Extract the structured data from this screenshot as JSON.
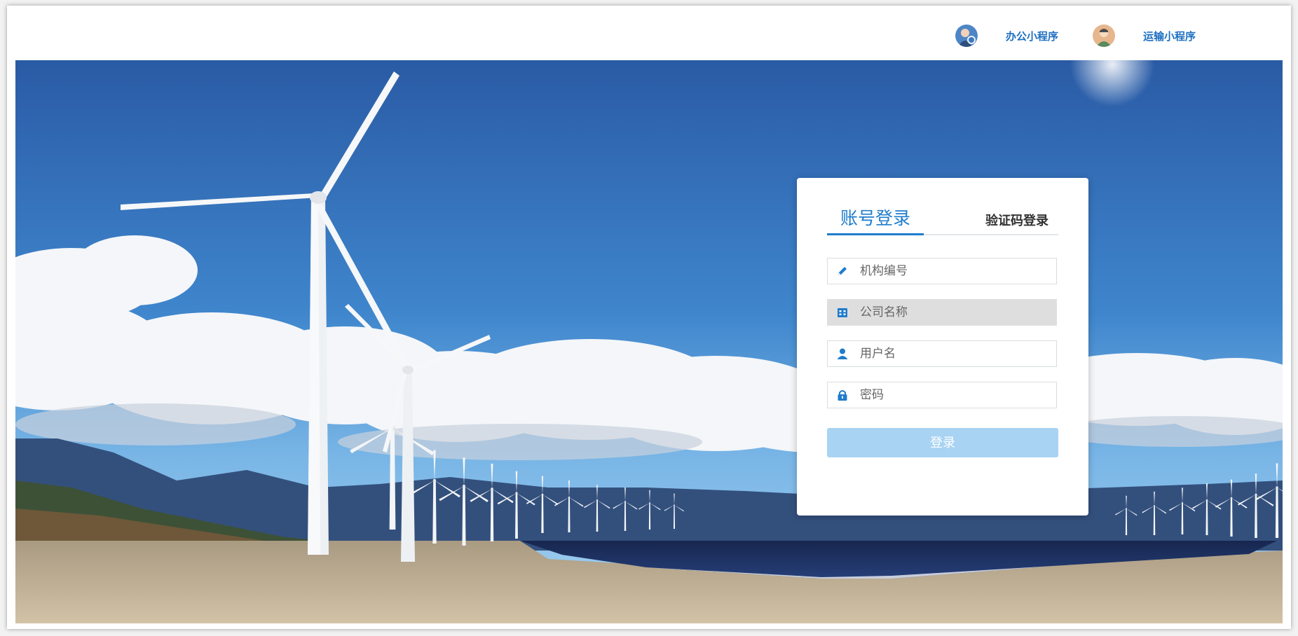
{
  "header": {
    "mini_programs": [
      {
        "label": "办公小程序",
        "icon": "office-avatar-icon"
      },
      {
        "label": "运输小程序",
        "icon": "transport-avatar-icon"
      }
    ]
  },
  "login": {
    "tabs": [
      {
        "label": "账号登录",
        "active": true
      },
      {
        "label": "验证码登录",
        "active": false
      }
    ],
    "fields": [
      {
        "placeholder": "机构编号",
        "icon": "pencil-icon",
        "disabled": false
      },
      {
        "placeholder": "公司名称",
        "icon": "building-icon",
        "disabled": true
      },
      {
        "placeholder": "用户名",
        "icon": "user-icon",
        "disabled": false
      },
      {
        "placeholder": "密码",
        "icon": "lock-icon",
        "disabled": false
      }
    ],
    "submit_label": "登录"
  },
  "colors": {
    "accent": "#1f7ccc",
    "header_link": "#1e6fc0",
    "button_disabled": "#a9d3f3",
    "sky_top": "#2a5fa8",
    "sea": "#1b2f5e",
    "sand": "#c9b89d"
  }
}
